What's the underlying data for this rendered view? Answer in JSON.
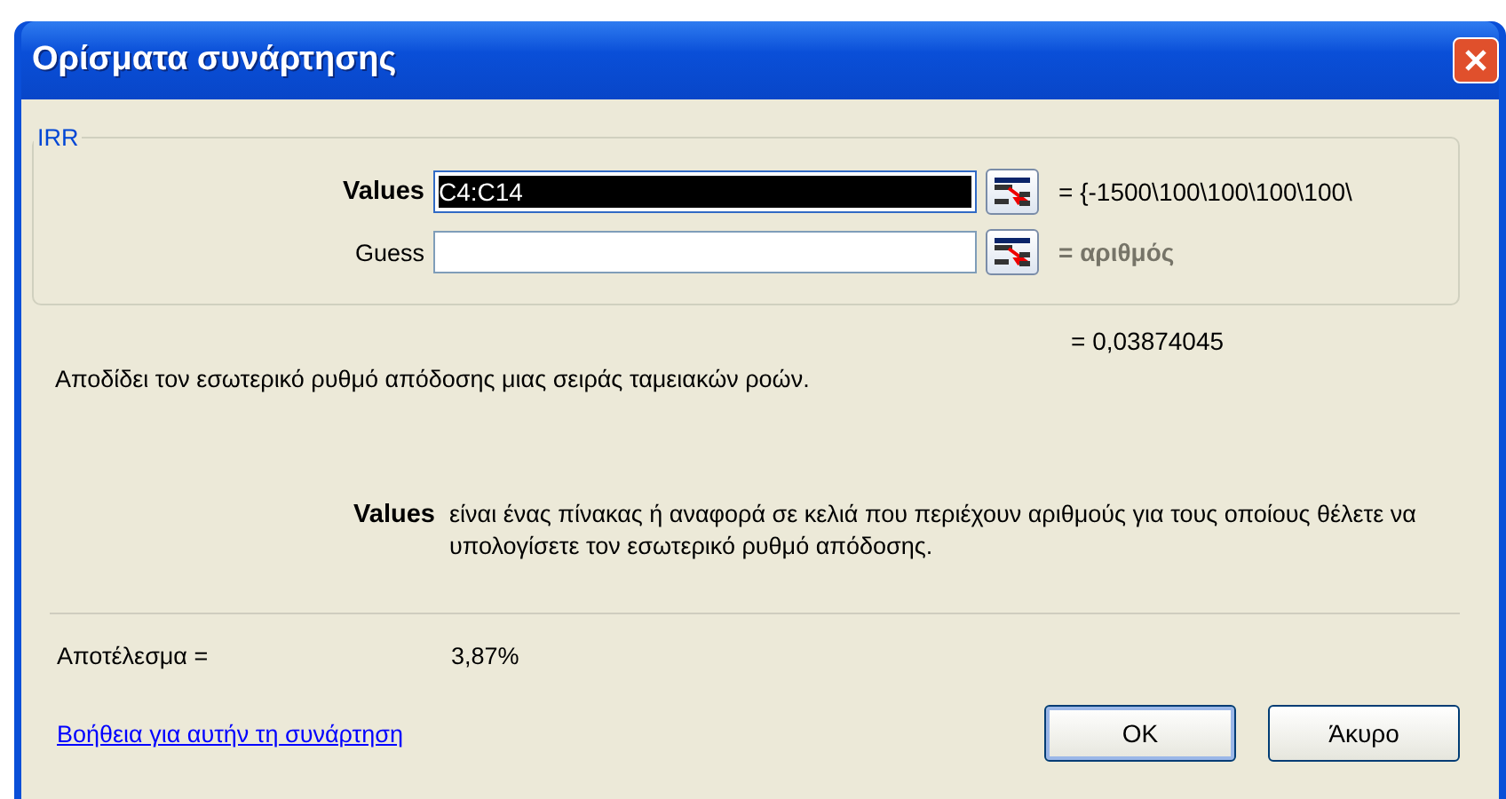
{
  "window": {
    "title": "Ορίσματα συνάρτησης"
  },
  "function_group": {
    "name": "IRR",
    "arguments": [
      {
        "label": "Values",
        "value": "C4:C14",
        "selected": true,
        "result": "= {-1500\\100\\100\\100\\100\\",
        "hint": false
      },
      {
        "label": "Guess",
        "selected": false,
        "result": "= αριθμός",
        "hint": true
      }
    ]
  },
  "formula_result": "= 0,03874045",
  "description": "Αποδίδει τον εσωτερικό ρυθμό απόδοσης μιας σειράς ταμειακών ροών.",
  "argument_help": {
    "name": "Values",
    "text": "είναι ένας πίνακας ή αναφορά σε κελιά που περιέχουν αριθμούς για τους οποίους θέλετε να υπολογίσετε τον εσωτερικό ρυθμό απόδοσης."
  },
  "result": {
    "label": "Αποτέλεσμα =",
    "value": "3,87%"
  },
  "help_link": "Βοήθεια για αυτήν τη συνάρτηση",
  "buttons": [
    {
      "label": "OK",
      "default": true
    },
    {
      "label": "Άκυρο",
      "default": false
    }
  ]
}
